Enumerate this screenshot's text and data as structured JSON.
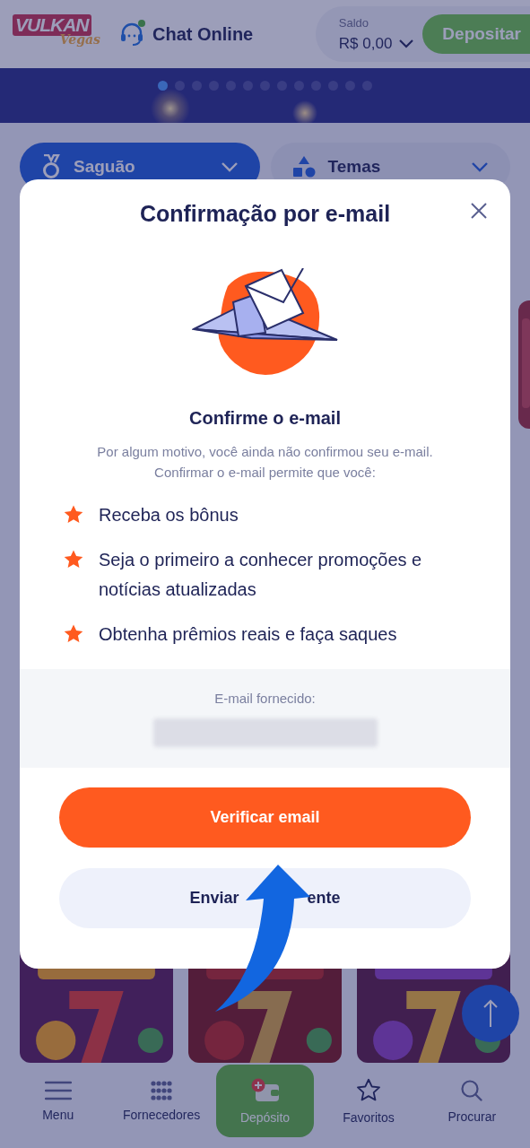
{
  "header": {
    "logo": {
      "word": "VULKAN",
      "script": "Vegas"
    },
    "chat": {
      "label": "Chat Online",
      "online": true
    },
    "balance": {
      "label": "Saldo",
      "value": "R$ 0,00"
    },
    "deposit_button": "Depositar"
  },
  "carousel": {
    "pages": [
      {
        "selected": true
      },
      {
        "selected": false
      },
      {
        "selected": false
      },
      {
        "selected": false
      },
      {
        "selected": false
      },
      {
        "selected": false
      },
      {
        "selected": false
      },
      {
        "selected": false
      },
      {
        "selected": false
      },
      {
        "selected": false
      },
      {
        "selected": false
      },
      {
        "selected": false
      },
      {
        "selected": false
      }
    ]
  },
  "filters": [
    {
      "label": "Saguão",
      "kind": "medal",
      "selected": true
    },
    {
      "label": "Temas",
      "kind": "shapes",
      "selected": false
    }
  ],
  "dialog": {
    "title": "Confirmação por e-mail",
    "heading": "Confirme o e-mail",
    "description": "Por algum motivo, você ainda não confirmou seu e-mail. Confirmar o e-mail permite que você:",
    "benefits": [
      "Receba os bônus",
      "Seja o primeiro a conhecer promoções e notícias atualizadas",
      "Obtenha prêmios reais e faça saques"
    ],
    "email_label": "E-mail fornecido:",
    "email_redacted": true,
    "primary_button": "Verificar email",
    "secondary_button": {
      "visible_parts": [
        "Enviar",
        "ente"
      ]
    }
  },
  "annotation": {
    "kind": "arrow"
  },
  "bottom_nav": [
    {
      "label": "Menu",
      "kind": "menu",
      "highlighted": false
    },
    {
      "label": "Fornecedores",
      "kind": "grid",
      "highlighted": false
    },
    {
      "label": "Depósito",
      "kind": "wallet",
      "highlighted": true
    },
    {
      "label": "Favoritos",
      "kind": "star",
      "highlighted": false
    },
    {
      "label": "Procurar",
      "kind": "search",
      "highlighted": false
    }
  ]
}
